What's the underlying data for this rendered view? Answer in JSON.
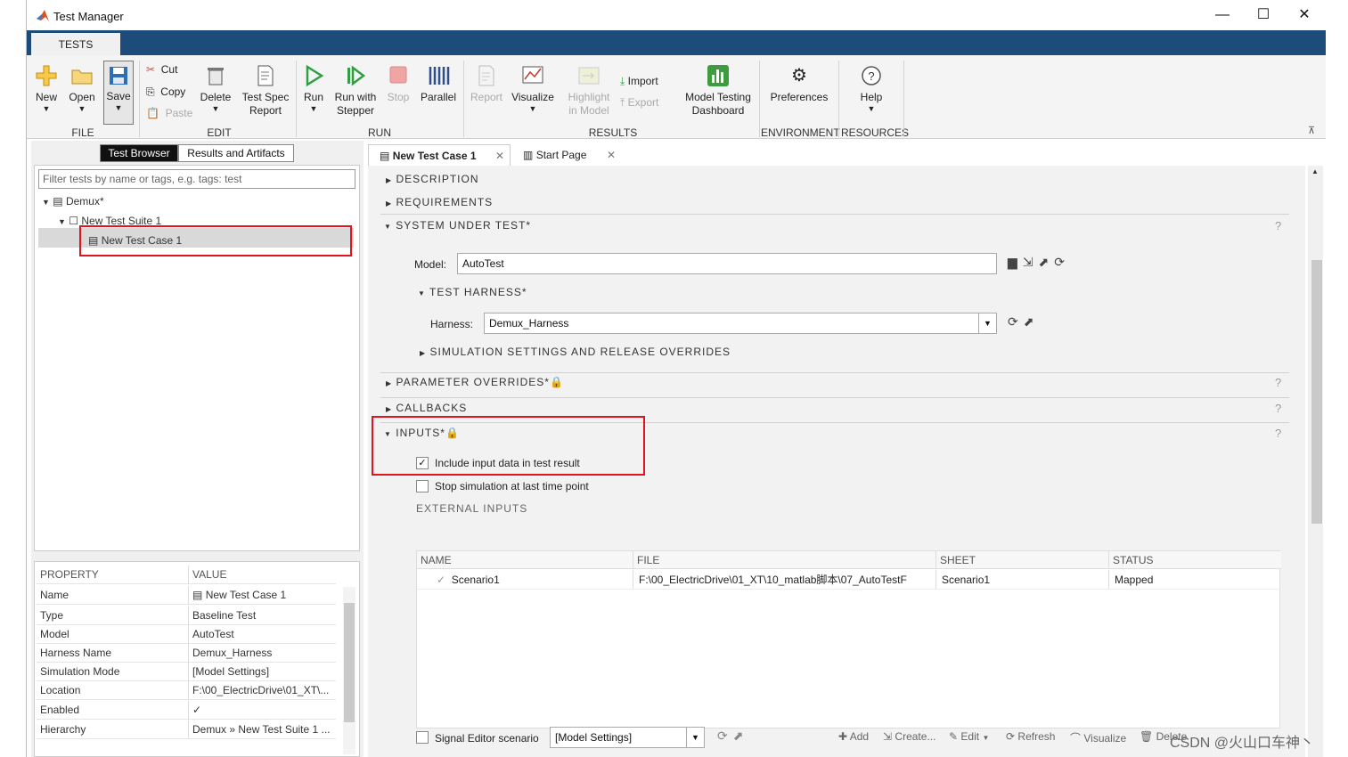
{
  "window": {
    "title": "Test Manager",
    "controls": {
      "minimize": "—",
      "maximize": "☐",
      "close": "✕"
    }
  },
  "ribbon": {
    "tab": "TESTS",
    "file": {
      "new": "New",
      "open": "Open",
      "save": "Save",
      "section": "FILE"
    },
    "edit": {
      "cut": "Cut",
      "copy": "Copy",
      "paste": "Paste",
      "delete": "Delete",
      "spec1": "Test Spec",
      "spec2": "Report",
      "section": "EDIT"
    },
    "run": {
      "run": "Run",
      "stepper1": "Run with",
      "stepper2": "Stepper",
      "stop": "Stop",
      "parallel": "Parallel",
      "section": "RUN"
    },
    "results": {
      "report": "Report",
      "visualize": "Visualize",
      "highlight1": "Highlight",
      "highlight2": "in Model",
      "import": "Import",
      "export": "Export",
      "dash1": "Model Testing",
      "dash2": "Dashboard",
      "section": "RESULTS"
    },
    "environment": {
      "preferences": "Preferences",
      "section": "ENVIRONMENT"
    },
    "resources": {
      "help": "Help",
      "section": "RESOURCES"
    }
  },
  "left": {
    "tabs": [
      "Test Browser",
      "Results and Artifacts"
    ],
    "filter_placeholder": "Filter tests by name or tags, e.g. tags: test",
    "tree": {
      "file": "Demux*",
      "suite": "New Test Suite 1",
      "case": "New Test Case 1"
    },
    "props": {
      "header": [
        "PROPERTY",
        "VALUE"
      ],
      "rows": [
        {
          "k": "Name",
          "v": "New Test Case 1"
        },
        {
          "k": "Type",
          "v": "Baseline Test"
        },
        {
          "k": "Model",
          "v": "AutoTest"
        },
        {
          "k": "Harness Name",
          "v": "Demux_Harness"
        },
        {
          "k": "Simulation Mode",
          "v": "[Model Settings]"
        },
        {
          "k": "Location",
          "v": "F:\\00_ElectricDrive\\01_XT\\..."
        },
        {
          "k": "Enabled",
          "v": "✓"
        },
        {
          "k": "Hierarchy",
          "v": "Demux » New Test Suite 1 ..."
        }
      ]
    }
  },
  "doc_tabs": [
    {
      "label": "New Test Case 1"
    },
    {
      "label": "Start Page"
    }
  ],
  "sections": {
    "description": "DESCRIPTION",
    "requirements": "REQUIREMENTS",
    "sut": "SYSTEM UNDER TEST*",
    "harness": "TEST HARNESS*",
    "sim": "SIMULATION SETTINGS AND RELEASE OVERRIDES",
    "params": "PARAMETER OVERRIDES*",
    "callbacks": "CALLBACKS",
    "inputs": "INPUTS*",
    "ext": "EXTERNAL INPUTS"
  },
  "sut": {
    "model_label": "Model:",
    "model_value": "AutoTest",
    "harness_label": "Harness:",
    "harness_value": "Demux_Harness"
  },
  "inputs": {
    "include_label": "Include input data in test result",
    "include_checked": true,
    "stop_label": "Stop simulation at last time point",
    "stop_checked": false,
    "table": {
      "columns": [
        "NAME",
        "FILE",
        "SHEET",
        "STATUS"
      ],
      "rows": [
        {
          "name": "Scenario1",
          "file": "F:\\00_ElectricDrive\\01_XT\\10_matlab脚本\\07_AutoTestF",
          "sheet": "Scenario1",
          "status": "Mapped"
        }
      ]
    },
    "actions": {
      "add": "Add",
      "create": "Create...",
      "edit": "Edit",
      "refresh": "Refresh",
      "visualize": "Visualize",
      "delete": "Delete"
    },
    "signal_label": "Signal Editor scenario",
    "signal_value": "[Model Settings]"
  },
  "watermark": "CSDN @火山口车神丶",
  "help_glyph": "?",
  "colors": {
    "ribbon_bar": "#1e4c7a",
    "highlight_box": "#e0141e",
    "run_green": "#2ea043"
  }
}
